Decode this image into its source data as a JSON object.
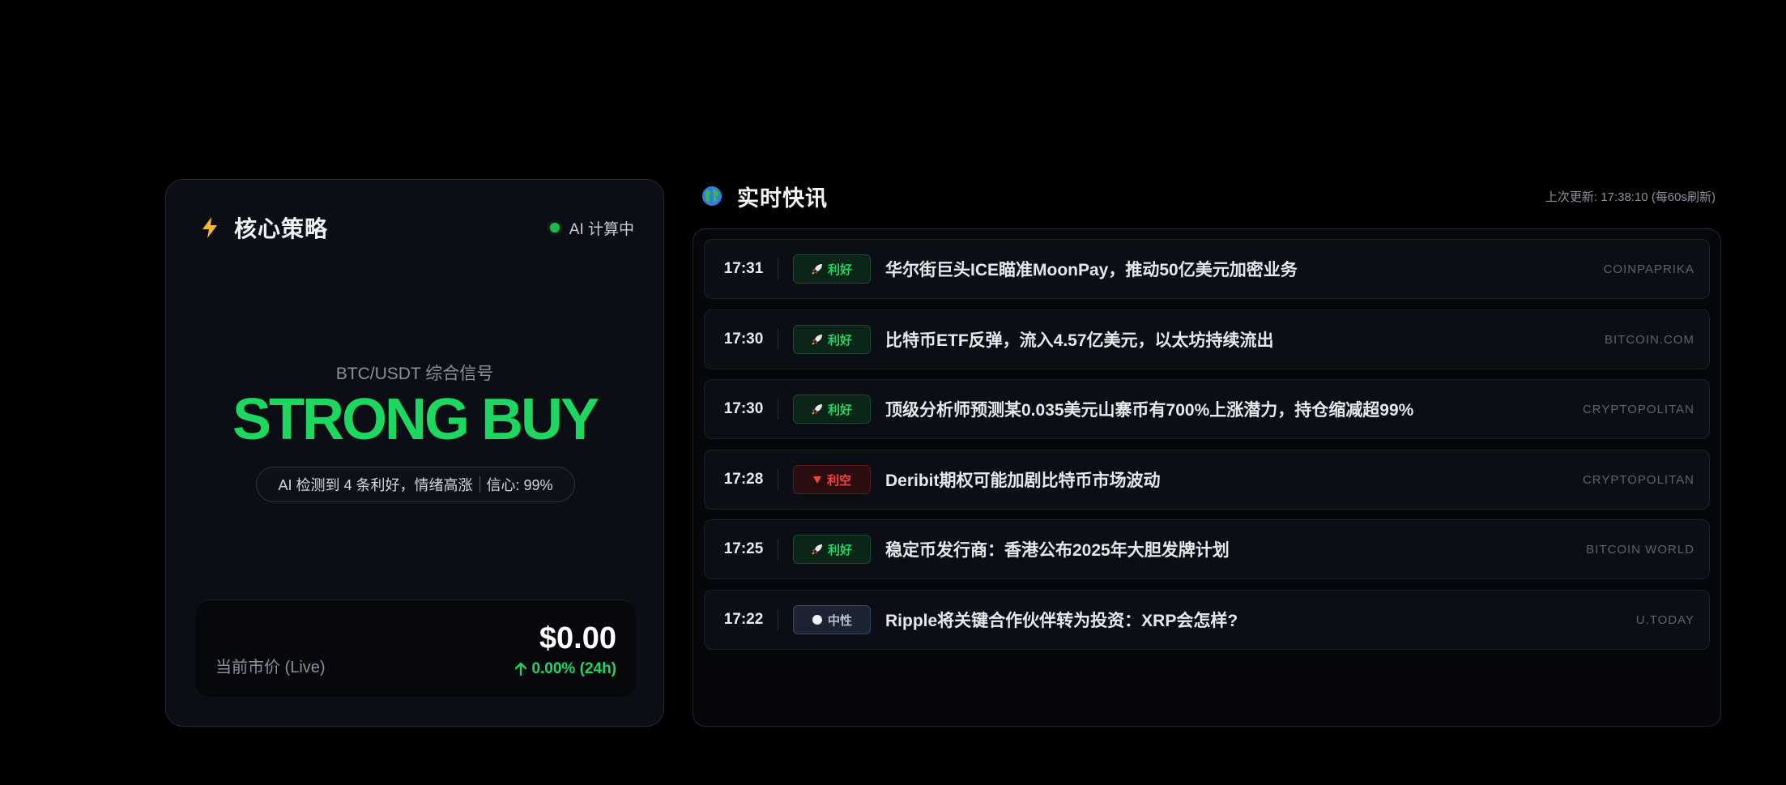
{
  "strategy": {
    "title": "核心策略",
    "status": "AI 计算中",
    "pair_label": "BTC/USDT 综合信号",
    "signal": "STRONG BUY",
    "summary": "AI 检测到 4 条利好，情绪高涨",
    "confidence": "信心: 99%",
    "price_label": "当前市价 (Live)",
    "price": "$0.00",
    "change": "0.00% (24h)",
    "colors": {
      "signal": "#1ed760",
      "status": "#1fb84a"
    }
  },
  "news": {
    "title": "实时快讯",
    "last_update": "上次更新: 17:38:10 (每60s刷新)",
    "items": [
      {
        "time": "17:31",
        "tag": "利好",
        "tag_type": "good",
        "headline": "华尔街巨头ICE瞄准MoonPay，推动50亿美元加密业务",
        "source": "COINPAPRIKA"
      },
      {
        "time": "17:30",
        "tag": "利好",
        "tag_type": "good",
        "headline": "比特币ETF反弹，流入4.57亿美元，以太坊持续流出",
        "source": "BITCOIN.COM"
      },
      {
        "time": "17:30",
        "tag": "利好",
        "tag_type": "good",
        "headline": "顶级分析师预测某0.035美元山寨币有700%上涨潜力，持仓缩减超99%",
        "source": "CRYPTOPOLITAN"
      },
      {
        "time": "17:28",
        "tag": "利空",
        "tag_type": "bad",
        "headline": "Deribit期权可能加剧比特币市场波动",
        "source": "CRYPTOPOLITAN"
      },
      {
        "time": "17:25",
        "tag": "利好",
        "tag_type": "good",
        "headline": "稳定币发行商：香港公布2025年大胆发牌计划",
        "source": "BITCOIN WORLD"
      },
      {
        "time": "17:22",
        "tag": "中性",
        "tag_type": "neutral",
        "headline": "Ripple将关键合作伙伴转为投资：XRP会怎样?",
        "source": "U.TODAY"
      }
    ],
    "icons": {
      "good": "rocket-icon",
      "bad": "down-triangle-icon",
      "neutral": "circle-icon"
    }
  }
}
